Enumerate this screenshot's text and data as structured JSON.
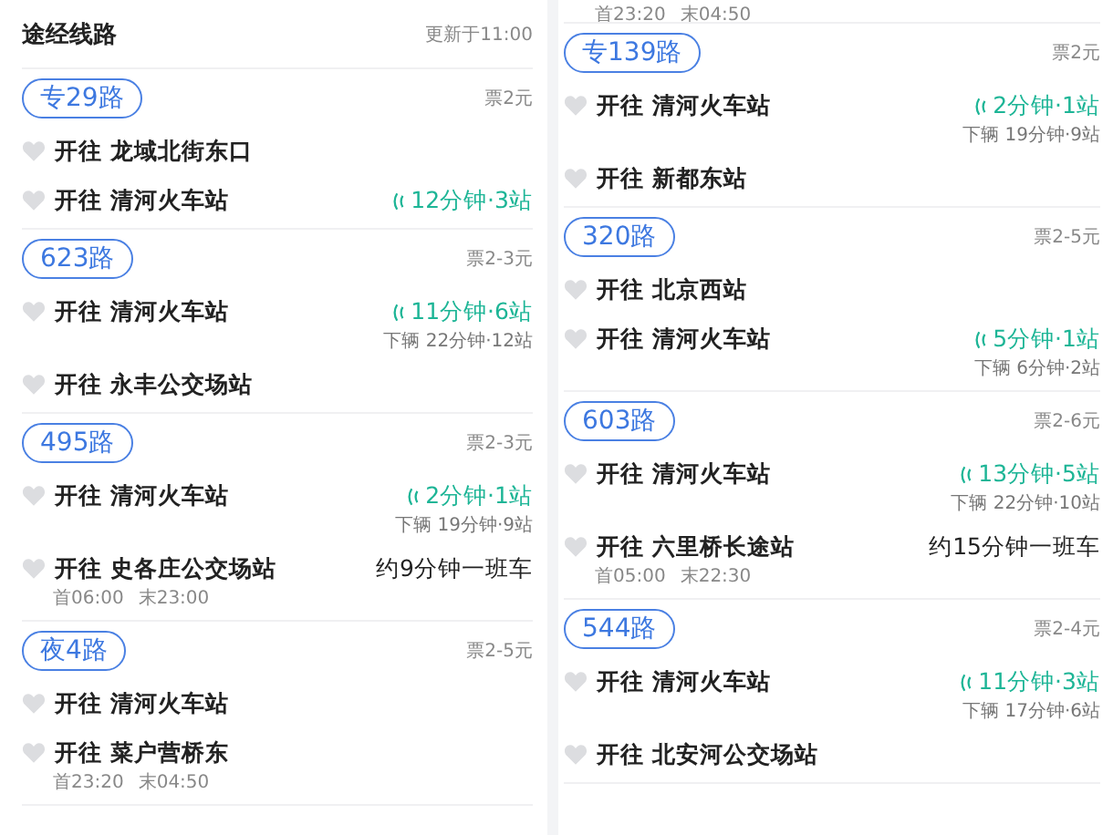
{
  "panels": [
    {
      "header": {
        "title": "途经线路",
        "updated": "更新于11:00"
      },
      "routes": [
        {
          "name": "专29路",
          "fare": "票2元",
          "directions": [
            {
              "prefix": "开往",
              "destination": "龙域北街东口"
            },
            {
              "prefix": "开往",
              "destination": "清河火车站",
              "eta": "12分钟·3站"
            }
          ]
        },
        {
          "name": "623路",
          "fare": "票2-3元",
          "directions": [
            {
              "prefix": "开往",
              "destination": "清河火车站",
              "eta": "11分钟·6站",
              "next": "下辆 22分钟·12站"
            },
            {
              "prefix": "开往",
              "destination": "永丰公交场站"
            }
          ]
        },
        {
          "name": "495路",
          "fare": "票2-3元",
          "directions": [
            {
              "prefix": "开往",
              "destination": "清河火车站",
              "eta": "2分钟·1站",
              "next": "下辆 19分钟·9站"
            },
            {
              "prefix": "开往",
              "destination": "史各庄公交场站",
              "frequency": "约9分钟一班车",
              "first": "首06:00",
              "last": "末23:00"
            }
          ]
        },
        {
          "name": "夜4路",
          "fare": "票2-5元",
          "directions": [
            {
              "prefix": "开往",
              "destination": "清河火车站"
            },
            {
              "prefix": "开往",
              "destination": "菜户营桥东",
              "first": "首23:20",
              "last": "末04:50"
            }
          ]
        }
      ]
    },
    {
      "top_times": {
        "first": "首23:20",
        "last": "末04:50"
      },
      "routes": [
        {
          "name": "专139路",
          "fare": "票2元",
          "directions": [
            {
              "prefix": "开往",
              "destination": "清河火车站",
              "eta": "2分钟·1站",
              "next": "下辆 19分钟·9站"
            },
            {
              "prefix": "开往",
              "destination": "新都东站"
            }
          ]
        },
        {
          "name": "320路",
          "fare": "票2-5元",
          "directions": [
            {
              "prefix": "开往",
              "destination": "北京西站"
            },
            {
              "prefix": "开往",
              "destination": "清河火车站",
              "eta": "5分钟·1站",
              "next": "下辆 6分钟·2站"
            }
          ]
        },
        {
          "name": "603路",
          "fare": "票2-6元",
          "directions": [
            {
              "prefix": "开往",
              "destination": "清河火车站",
              "eta": "13分钟·5站",
              "next": "下辆 22分钟·10站"
            },
            {
              "prefix": "开往",
              "destination": "六里桥长途站",
              "frequency": "约15分钟一班车",
              "first": "首05:00",
              "last": "末22:30"
            }
          ]
        },
        {
          "name": "544路",
          "fare": "票2-4元",
          "directions": [
            {
              "prefix": "开往",
              "destination": "清河火车站",
              "eta": "11分钟·3站",
              "next": "下辆 17分钟·6站"
            },
            {
              "prefix": "开往",
              "destination": "北安河公交场站"
            }
          ]
        }
      ]
    }
  ]
}
